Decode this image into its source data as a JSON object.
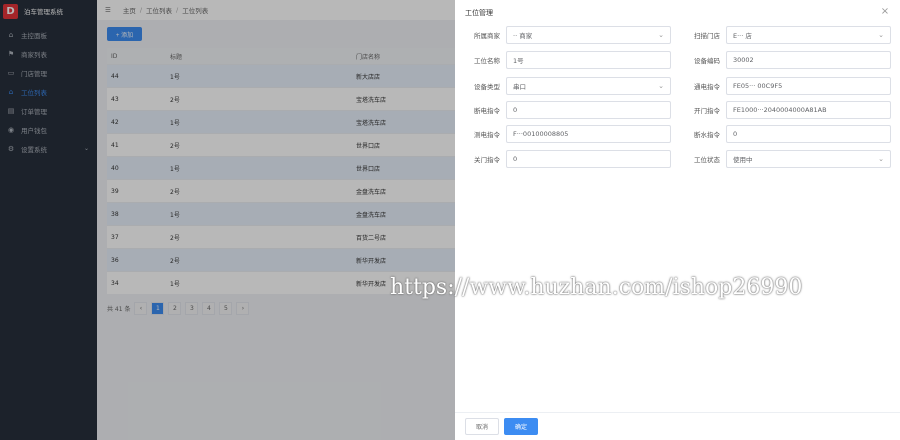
{
  "app": {
    "title": "泊车管理系统",
    "logo_letter": "D"
  },
  "sidebar": {
    "items": [
      {
        "icon": "home-icon",
        "label": "主控面板"
      },
      {
        "icon": "flag-icon",
        "label": "商家列表"
      },
      {
        "icon": "monitor-icon",
        "label": "门店管理"
      },
      {
        "icon": "location-icon",
        "label": "工位列表"
      },
      {
        "icon": "doc-icon",
        "label": "订单管理"
      },
      {
        "icon": "user-icon",
        "label": "用户钱包"
      },
      {
        "icon": "gear-icon",
        "label": "设置系统"
      }
    ]
  },
  "breadcrumb": {
    "home": "主页",
    "section": "工位列表",
    "page": "工位列表"
  },
  "toolbar": {
    "add_label": "+ 添加"
  },
  "table": {
    "columns": [
      "ID",
      "标题",
      "门店名称"
    ],
    "rows": [
      {
        "id": "44",
        "title": "1号",
        "store": "新大店店"
      },
      {
        "id": "43",
        "title": "2号",
        "store": "宝塔洗车店"
      },
      {
        "id": "42",
        "title": "1号",
        "store": "宝塔洗车店"
      },
      {
        "id": "41",
        "title": "2号",
        "store": "世界口店"
      },
      {
        "id": "40",
        "title": "1号",
        "store": "世界口店"
      },
      {
        "id": "39",
        "title": "2号",
        "store": "金盘洗车店"
      },
      {
        "id": "38",
        "title": "1号",
        "store": "金盘洗车店"
      },
      {
        "id": "37",
        "title": "2号",
        "store": "百货二号店"
      },
      {
        "id": "36",
        "title": "2号",
        "store": "新华开发店"
      },
      {
        "id": "34",
        "title": "1号",
        "store": "新华开发店"
      }
    ]
  },
  "pager": {
    "total": "共 41 条",
    "prev": "‹",
    "next": "›",
    "pages": [
      "1",
      "2",
      "3",
      "4",
      "5"
    ]
  },
  "panel": {
    "title": "工位管理",
    "fields": {
      "merchant_label": "所属商家",
      "merchant_value": "·· 商家",
      "store_label": "扫描门店",
      "store_value": "E··· 店",
      "name_label": "工位名称",
      "name_value": "1号",
      "code_label": "设备编码",
      "code_value": "30002",
      "type_label": "设备类型",
      "type_value": "串口",
      "poweron_label": "通电指令",
      "poweron_value": "FE05··· 00C9F5",
      "poweroff_label": "断电指令",
      "poweroff_value": "0",
      "open_label": "开门指令",
      "open_value": "FE1000···2040004000A81AB",
      "test_label": "测电指令",
      "test_value": "F···00100008805",
      "water_label": "断水指令",
      "water_value": "0",
      "close_label": "关门指令",
      "close_value": "0",
      "status_label": "工位状态",
      "status_value": "使用中"
    },
    "cancel_label": "取消",
    "ok_label": "确定"
  },
  "watermark": "https://www.huzhan.com/ishop26990",
  "colors": {
    "primary": "#3c8cf2",
    "sidebar": "#28303c",
    "logo": "#e3343a"
  }
}
